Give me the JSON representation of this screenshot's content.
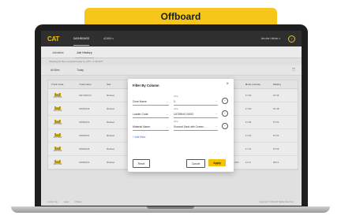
{
  "banner": {
    "title": "Offboard"
  },
  "app": {
    "logo": "CAT",
    "nav": [
      "DASHBOARD",
      "ADMIN ▾"
    ],
    "user": "Jennifer Hibbler ▾",
    "help_icon": "?",
    "subtabs": [
      "Jobsites",
      "Job History"
    ],
    "hint": "Showing job files completed today by (UTC +1:00) EAT",
    "filters": [
      "All Sites",
      "Today"
    ],
    "filter_icon": "funnel-icon",
    "table": {
      "headers": [
        "Truck Code",
        "Truck name",
        "Site",
        "",
        "",
        "",
        "Name",
        "Mode (minute)",
        "Waiting"
      ],
      "rows": [
        {
          "machine": "MACHINE",
          "cols": [
            "SR72953 R",
            "Banlaw",
            "",
            "",
            "",
            "FILL INC.",
            "17:00",
            "07:46"
          ]
        },
        {
          "machine": "MACHINE",
          "cols": [
            "SW60218",
            "Banlaw",
            "",
            "",
            "",
            "FILL INC.",
            "17:00",
            "07:48"
          ]
        },
        {
          "machine": "MACHINE",
          "cols": [
            "SW60219",
            "Banlaw",
            "",
            "",
            "",
            "FILL INC.",
            "17:05",
            "07:51"
          ]
        },
        {
          "machine": "MACHINE",
          "cols": [
            "SW60222",
            "Banlaw",
            "",
            "",
            "",
            "FILL INC.",
            "17:44",
            "07:54"
          ]
        },
        {
          "machine": "MACHINE",
          "cols": [
            "SW60218",
            "Banlaw",
            "",
            "",
            "",
            "FILL INC.",
            "17:41",
            "07:55"
          ]
        },
        {
          "machine": "MACHINE",
          "cols": [
            "SW60219",
            "Banlaw",
            "2",
            "44 N",
            "",
            "GENERAL FILL INC.",
            "14:11",
            "08:11"
          ]
        }
      ]
    },
    "footer": {
      "links": [
        "Cookie List",
        "Legal",
        "Privacy"
      ],
      "copyright": "Copyright © 2024 All Rights Reserved"
    }
  },
  "modal": {
    "title": "Filter By Column",
    "close_icon": "×",
    "rows": [
      {
        "column": "Zone Name",
        "value_label": "Value",
        "value": "3"
      },
      {
        "column": "Loader Code",
        "value_label": "Value",
        "value": "CATSBNO 00193"
      },
      {
        "column": "Material Name",
        "value_label": "Value",
        "value": "Sourced Sand with Cemen..."
      }
    ],
    "add_more": "+ Add More",
    "reset_label": "Reset",
    "cancel_label": "Cancel",
    "apply_label": "Apply"
  }
}
